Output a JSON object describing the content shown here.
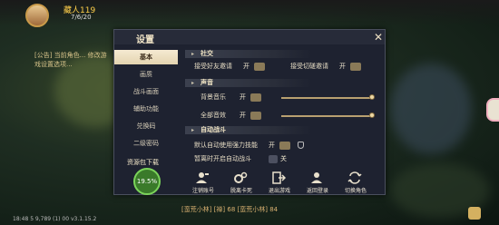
{
  "hud": {
    "player_name": "藏人119",
    "player_hp": "7/6/20",
    "top_right": "",
    "chat_left": "[公告] 当前角色... 修改游戏设置选项...",
    "chat_bottom": "[蛮荒小林] [禅] 68 [蛮荒小林] 84",
    "status": "18:48 5 9,789 (1) 00 v3.1.15.2"
  },
  "dialog": {
    "title": "设置",
    "close": "✕",
    "menu": [
      "基本",
      "画质",
      "战斗画面",
      "辅助功能",
      "兑换码",
      "二级密码"
    ],
    "resource": {
      "label": "资源包下载",
      "progress_text": "19.5%",
      "progress": 0.195
    },
    "sections": {
      "social": {
        "title": "社交",
        "friend_label": "接受好友邀请",
        "friend_state": "开",
        "cut_label": "接受切磋邀请",
        "cut_state": "开"
      },
      "sound": {
        "title": "声音",
        "music_label": "背景音乐",
        "music_state": "开",
        "music_level": 1.0,
        "sfx_label": "全部音效",
        "sfx_state": "开",
        "sfx_level": 1.0
      },
      "auto": {
        "title": "自动战斗",
        "skill_label": "默认自动使用强力技能",
        "skill_state": "开",
        "leave_label": "暂离时开启自动战斗",
        "leave_state": "关"
      }
    },
    "actions": [
      "注销账号",
      "脱离卡死",
      "退出游戏",
      "返回登录",
      "切换角色"
    ]
  },
  "colors": {
    "accent": "#e4d4b0",
    "panel": "#1e2230",
    "track": "#b8a070"
  }
}
